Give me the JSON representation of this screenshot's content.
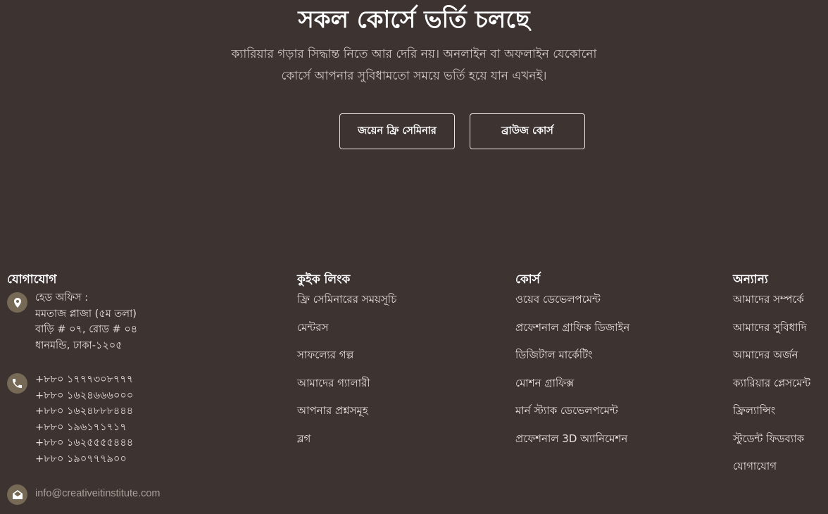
{
  "hero": {
    "title": "সকল কোর্সে ভর্তি চলছে",
    "subtitle_line1": "ক্যারিয়ার গড়ার সিদ্ধান্ত নিতে আর দেরি নয়। অনলাইন বা অফলাইন যেকোনো",
    "subtitle_line2": "কোর্সে আপনার সুবিধামতো সময়ে ভর্তি হয়ে যান এখনই।",
    "btn_seminar": "জয়েন ফ্রি সেমিনার",
    "btn_course": "ব্রাউজ কোর্স"
  },
  "footer": {
    "contact": {
      "title": "যোগাযোগ",
      "address_lines": [
        "হেড অফিস :",
        "মমতাজ প্লাজা (৫ম তলা)",
        "বাড়ি # ০৭, রোড # ০৪",
        "ধানমন্ডি, ঢাকা-১২০৫"
      ],
      "phones": [
        "+৮৮০ ১৭৭৭৩০৮৭৭৭",
        "+৮৮০ ১৬২৪৬৬৬০০০",
        "+৮৮০ ১৬২৪৮৮৮৪৪৪",
        "+৮৮০ ১৯৬১৭১৭১৭",
        "+৮৮০ ১৬২৫৫৫৫৪৪৪",
        "+৮৮০ ১৯০৭৭৭৯০০"
      ],
      "email": "info@creativeitinstitute.com",
      "icons": [
        "location-pin-icon",
        "phone-icon",
        "mail-icon"
      ]
    },
    "quick_links": {
      "title": "কুইক লিংক",
      "items": [
        "ফ্রি সেমিনারের সময়সূচি",
        "মেন্টরস",
        "সাফল্যের গল্প",
        "আমাদের গ্যালারী",
        "আপনার প্রশ্নসমূহ",
        "ব্লগ"
      ]
    },
    "courses": {
      "title": "কোর্স",
      "items": [
        "ওয়েব ডেভেলপমেন্ট",
        "প্রফেশনাল গ্রাফিক ডিজাইন",
        "ডিজিটাল মার্কেটিং",
        "মোশন গ্রাফিক্স",
        "মার্ন স্ট্যাক ডেভেলপমেন্ট",
        "প্রফেশনাল 3D অ্যানিমেশন"
      ]
    },
    "others": {
      "title": "অন্যান্য",
      "items": [
        "আমাদের সম্পর্কে",
        "আমাদের সুবিধাদি",
        "আমাদের অর্জন",
        "ক্যারিয়ার প্লেসমেন্ট",
        "ফ্রিল্যান্সিং",
        "স্টুডেন্ট ফিডব্যাক",
        "যোগাযোগ"
      ]
    }
  },
  "colors": {
    "background": "#3d3331",
    "icon_bg": "#766955",
    "button_border": "#e9e4e1"
  }
}
